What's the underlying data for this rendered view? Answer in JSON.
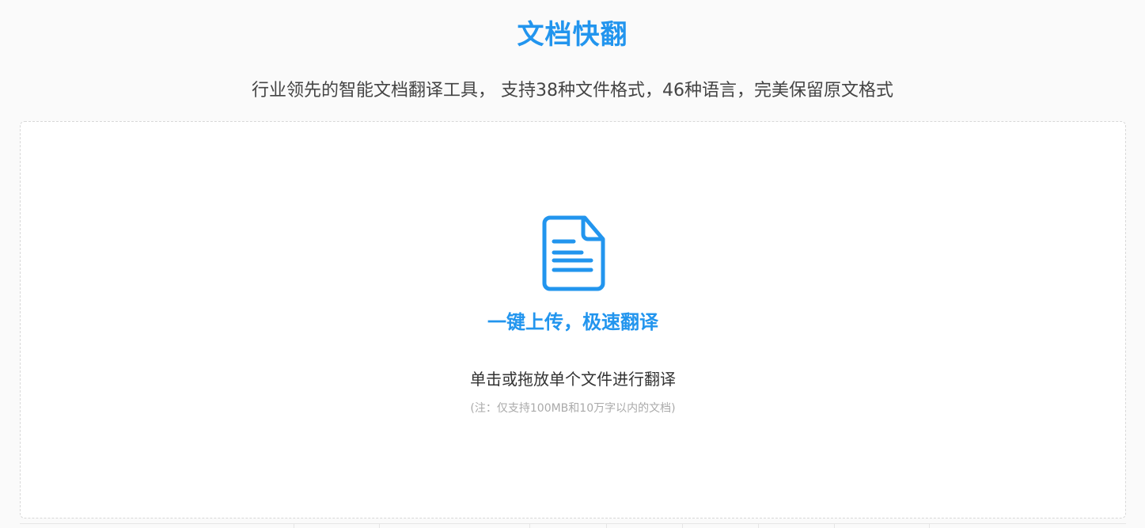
{
  "header": {
    "title": "文档快翻",
    "subtitle": "行业领先的智能文档翻译工具， 支持38种文件格式，46种语言，完美保留原文格式"
  },
  "upload": {
    "icon": "document-icon",
    "heading": "一键上传，极速翻译",
    "hint": "单击或拖放单个文件进行翻译",
    "note": "(注：仅支持100MB和10万字以内的文档)"
  },
  "colors": {
    "accent": "#2295ee",
    "text": "#333333",
    "muted": "#aaaaaa",
    "border": "#d8d8d8"
  }
}
